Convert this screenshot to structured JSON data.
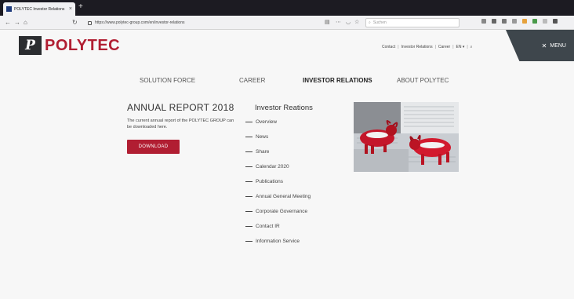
{
  "browser": {
    "tab_title": "POLYTEC Investor Relations",
    "tab_close": "×",
    "new_tab": "+",
    "url": "https://www.polytec-group.com/en/investor-relations",
    "search_placeholder": "Suchen",
    "nav_glyphs": {
      "back": "←",
      "forward": "→",
      "home": "⌂",
      "reload": "↻"
    }
  },
  "site": {
    "logo_mark": "P",
    "logo_text": "POLYTEC",
    "topnav": {
      "contact": "Contact",
      "investor_relations": "Investor Relations",
      "career": "Career",
      "language": "EN ▾",
      "search": "⌕",
      "sep": "|"
    },
    "menu": {
      "icon": "✕",
      "label": "MENU"
    },
    "mainnav": {
      "solution_force": "SOLUTION FORCE",
      "career": "CAREER",
      "investor_relations": "INVESTOR RELATIONS",
      "about": "ABOUT POLYTEC"
    }
  },
  "report": {
    "title": "ANNUAL REPORT 2018",
    "text": "The current annual report of the POLYTEC GROUP can be downloaded here.",
    "button": "DOWNLOAD"
  },
  "investor_relations": {
    "heading": "Investor Reations",
    "items": [
      "Overview",
      "News",
      "Share",
      "Calendar 2020",
      "Publications",
      "Annual General Meeting",
      "Corporate Governance",
      "Contact IR",
      "Information Service"
    ]
  },
  "colors": {
    "brand_red": "#b11e32",
    "menu_gray": "#3e464c",
    "chrome_dark": "#1c1b22"
  }
}
